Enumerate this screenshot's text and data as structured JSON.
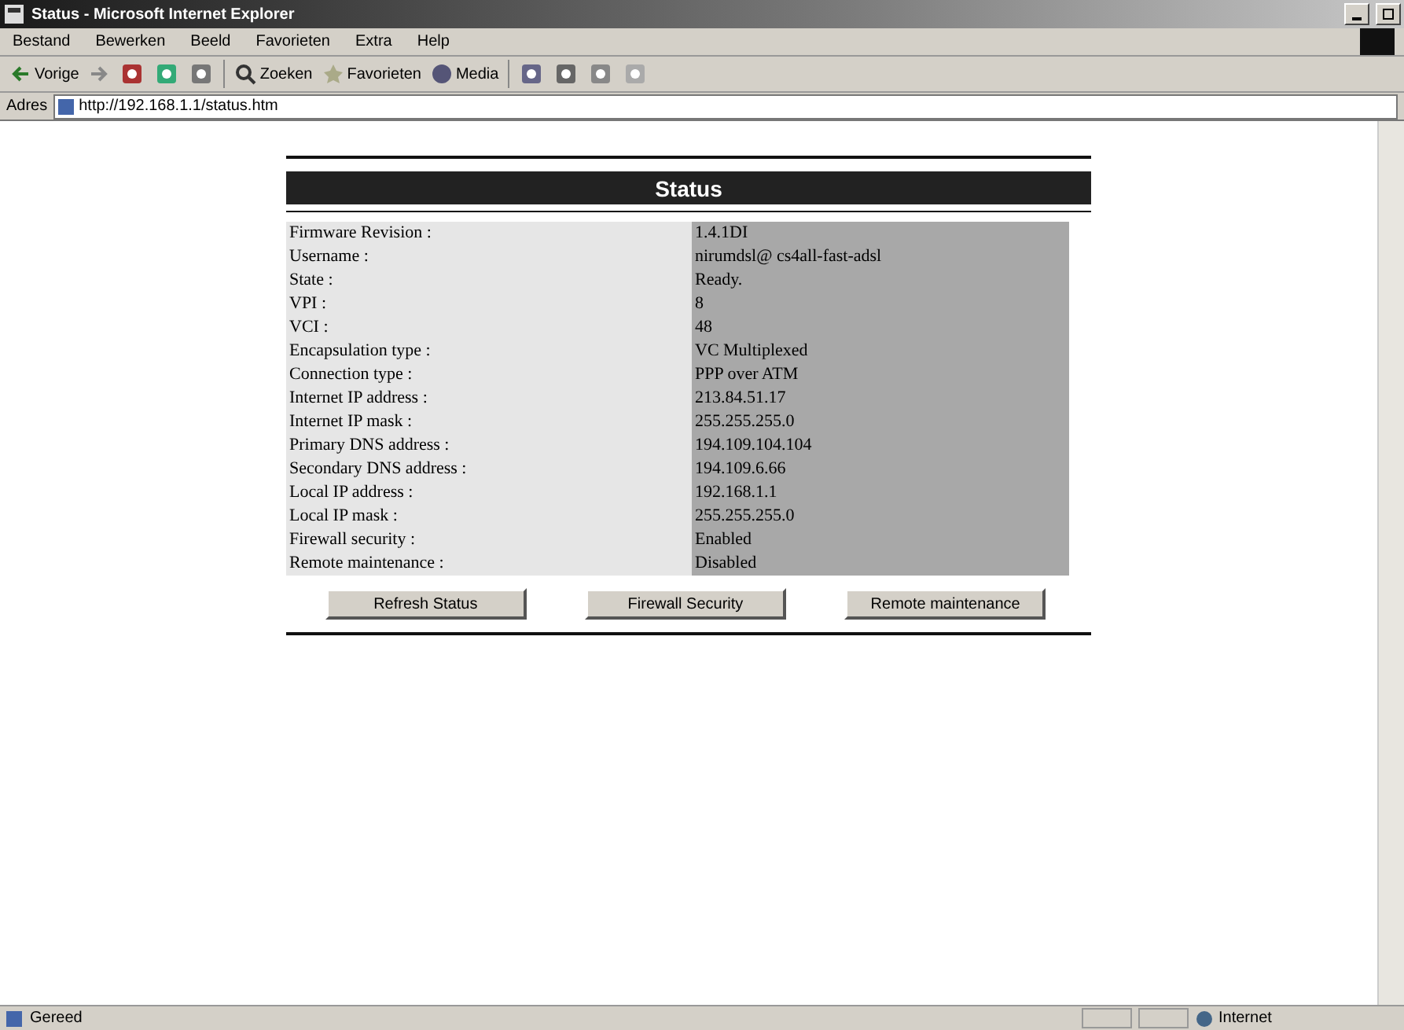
{
  "window": {
    "title": "Status - Microsoft Internet Explorer"
  },
  "menu": [
    "Bestand",
    "Bewerken",
    "Beeld",
    "Favorieten",
    "Extra",
    "Help"
  ],
  "toolbar": {
    "back": "Vorige",
    "search": "Zoeken",
    "favorites": "Favorieten",
    "media": "Media"
  },
  "address": {
    "label": "Adres",
    "url": "http://192.168.1.1/status.htm"
  },
  "page": {
    "heading": "Status",
    "rows": [
      {
        "label": "Firmware Revision :",
        "value": "1.4.1DI"
      },
      {
        "label": "Username :",
        "value": "nirumdsl@ cs4all-fast-adsl"
      },
      {
        "label": "State :",
        "value": "Ready."
      },
      {
        "label": "VPI :",
        "value": "8"
      },
      {
        "label": "VCI :",
        "value": "48"
      },
      {
        "label": "Encapsulation type :",
        "value": "VC Multiplexed"
      },
      {
        "label": "Connection type :",
        "value": "PPP over ATM"
      },
      {
        "label": "Internet IP address :",
        "value": "213.84.51.17"
      },
      {
        "label": "Internet IP mask :",
        "value": "255.255.255.0"
      },
      {
        "label": "Primary DNS address :",
        "value": "194.109.104.104"
      },
      {
        "label": "Secondary DNS address :",
        "value": "194.109.6.66"
      },
      {
        "label": "Local IP address :",
        "value": "192.168.1.1"
      },
      {
        "label": "Local IP mask :",
        "value": "255.255.255.0"
      },
      {
        "label": "Firewall security :",
        "value": "Enabled"
      },
      {
        "label": "Remote maintenance :",
        "value": "Disabled"
      }
    ],
    "buttons": [
      "Refresh Status",
      "Firewall Security",
      "Remote maintenance"
    ]
  },
  "status_bar": {
    "text": "Gereed",
    "zone": "Internet"
  }
}
